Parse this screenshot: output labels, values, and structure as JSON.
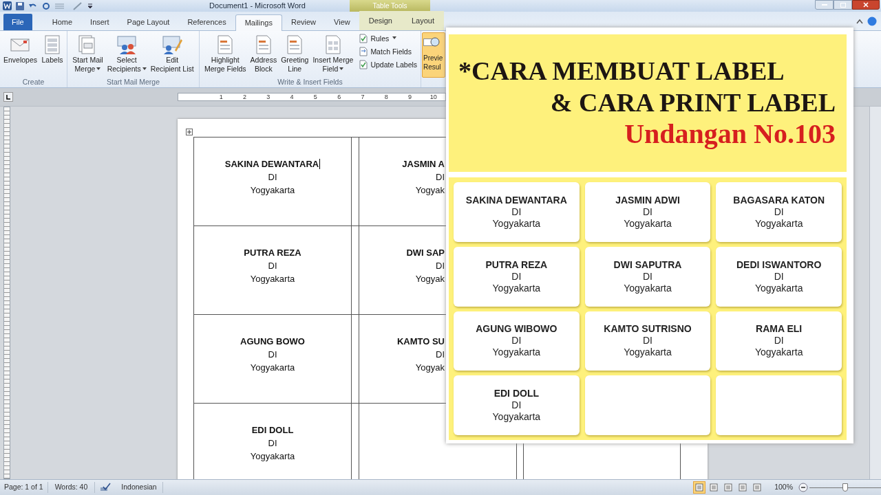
{
  "title_bar": {
    "title": "Document1 - Microsoft Word",
    "contextual_header": "Table Tools"
  },
  "tabs": [
    {
      "label": "File",
      "kind": "file",
      "selected": false
    },
    {
      "label": "Home",
      "kind": "tab",
      "selected": false
    },
    {
      "label": "Insert",
      "kind": "tab",
      "selected": false
    },
    {
      "label": "Page Layout",
      "kind": "tab",
      "selected": false
    },
    {
      "label": "References",
      "kind": "tab",
      "selected": false
    },
    {
      "label": "Mailings",
      "kind": "tab",
      "selected": true
    },
    {
      "label": "Review",
      "kind": "tab",
      "selected": false
    },
    {
      "label": "View",
      "kind": "tab",
      "selected": false
    },
    {
      "label": "Design",
      "kind": "contextual",
      "selected": false
    },
    {
      "label": "Layout",
      "kind": "contextual",
      "selected": false
    }
  ],
  "ribbon_groups": [
    {
      "label": "Create",
      "items": [
        {
          "kind": "large",
          "lines": [
            "Envelopes"
          ],
          "dropdown": false
        },
        {
          "kind": "large",
          "lines": [
            "Labels"
          ],
          "dropdown": false
        }
      ]
    },
    {
      "label": "Start Mail Merge",
      "items": [
        {
          "kind": "large",
          "lines": [
            "Start Mail",
            "Merge"
          ],
          "dropdown": true
        },
        {
          "kind": "large",
          "lines": [
            "Select",
            "Recipients"
          ],
          "dropdown": true
        },
        {
          "kind": "large",
          "lines": [
            "Edit",
            "Recipient List"
          ],
          "dropdown": false
        }
      ]
    },
    {
      "label": "Write & Insert Fields",
      "items": [
        {
          "kind": "large",
          "lines": [
            "Highlight",
            "Merge Fields"
          ],
          "dropdown": false
        },
        {
          "kind": "large",
          "lines": [
            "Address",
            "Block"
          ],
          "dropdown": false
        },
        {
          "kind": "large",
          "lines": [
            "Greeting",
            "Line"
          ],
          "dropdown": false
        },
        {
          "kind": "large",
          "lines": [
            "Insert Merge",
            "Field"
          ],
          "dropdown": true
        },
        {
          "kind": "small",
          "lines": [
            "Rules"
          ],
          "dropdown": true
        },
        {
          "kind": "small",
          "lines": [
            "Match Fields"
          ],
          "dropdown": false
        },
        {
          "kind": "small",
          "lines": [
            "Update Labels"
          ],
          "dropdown": false
        }
      ]
    }
  ],
  "preview_button": {
    "lines": [
      "Previe",
      "Resul"
    ],
    "highlighted": true
  },
  "ruler": {
    "numbers": [
      "1",
      "2",
      "3",
      "4",
      "5",
      "6",
      "7",
      "8",
      "9",
      "10"
    ]
  },
  "document": {
    "rows": [
      {
        "cells": [
          {
            "lines": [
              "SAKINA DEWANTARA",
              "DI",
              "Yogyakarta"
            ],
            "cursor": true
          },
          {
            "lines": [
              "JASMIN A",
              "DI",
              "Yogyak"
            ],
            "cursor": false
          }
        ]
      },
      {
        "cells": [
          {
            "lines": [
              "PUTRA REZA",
              "DI",
              "Yogyakarta"
            ],
            "cursor": false
          },
          {
            "lines": [
              "DWI SAP",
              "DI",
              "Yogyak"
            ],
            "cursor": false
          }
        ]
      },
      {
        "cells": [
          {
            "lines": [
              "AGUNG BOWO",
              "DI",
              "Yogyakarta"
            ],
            "cursor": false
          },
          {
            "lines": [
              "KAMTO SU",
              "DI",
              "Yogyak"
            ],
            "cursor": false
          }
        ]
      },
      {
        "cells": [
          {
            "lines": [
              "EDI DOLL",
              "DI",
              "Yogyakarta"
            ],
            "cursor": false
          }
        ]
      }
    ]
  },
  "overlay": {
    "heading": [
      {
        "text": "*CARA MEMBUAT LABEL",
        "kind": "title"
      },
      {
        "text": "& CARA PRINT LABEL",
        "kind": "title"
      },
      {
        "text": "Undangan No.103",
        "kind": "subtitle"
      }
    ],
    "labels": [
      {
        "kind": "filled",
        "lines": [
          "SAKINA DEWANTARA",
          "DI",
          "Yogyakarta"
        ]
      },
      {
        "kind": "filled",
        "lines": [
          "JASMIN ADWI",
          "DI",
          "Yogyakarta"
        ]
      },
      {
        "kind": "filled",
        "lines": [
          "BAGASARA KATON",
          "DI",
          "Yogyakarta"
        ]
      },
      {
        "kind": "filled",
        "lines": [
          "PUTRA REZA",
          "DI",
          "Yogyakarta"
        ]
      },
      {
        "kind": "filled",
        "lines": [
          "DWI SAPUTRA",
          "DI",
          "Yogyakarta"
        ]
      },
      {
        "kind": "filled",
        "lines": [
          "DEDI ISWANTORO",
          "DI",
          "Yogyakarta"
        ]
      },
      {
        "kind": "filled",
        "lines": [
          "AGUNG WIBOWO",
          "DI",
          "Yogyakarta"
        ]
      },
      {
        "kind": "filled",
        "lines": [
          "KAMTO SUTRISNO",
          "DI",
          "Yogyakarta"
        ]
      },
      {
        "kind": "filled",
        "lines": [
          "RAMA ELI",
          "DI",
          "Yogyakarta"
        ]
      },
      {
        "kind": "filled",
        "lines": [
          "EDI DOLL",
          "DI",
          "Yogyakarta"
        ]
      },
      {
        "kind": "empty"
      },
      {
        "kind": "empty"
      }
    ]
  },
  "status_bar": {
    "page": "Page: 1 of 1",
    "words": "Words: 40",
    "language": "Indonesian",
    "views": [
      {
        "selected": true
      },
      {
        "selected": false
      },
      {
        "selected": false
      },
      {
        "selected": false
      },
      {
        "selected": false
      }
    ],
    "zoom": {
      "label": "100%",
      "level": 0.5
    }
  }
}
